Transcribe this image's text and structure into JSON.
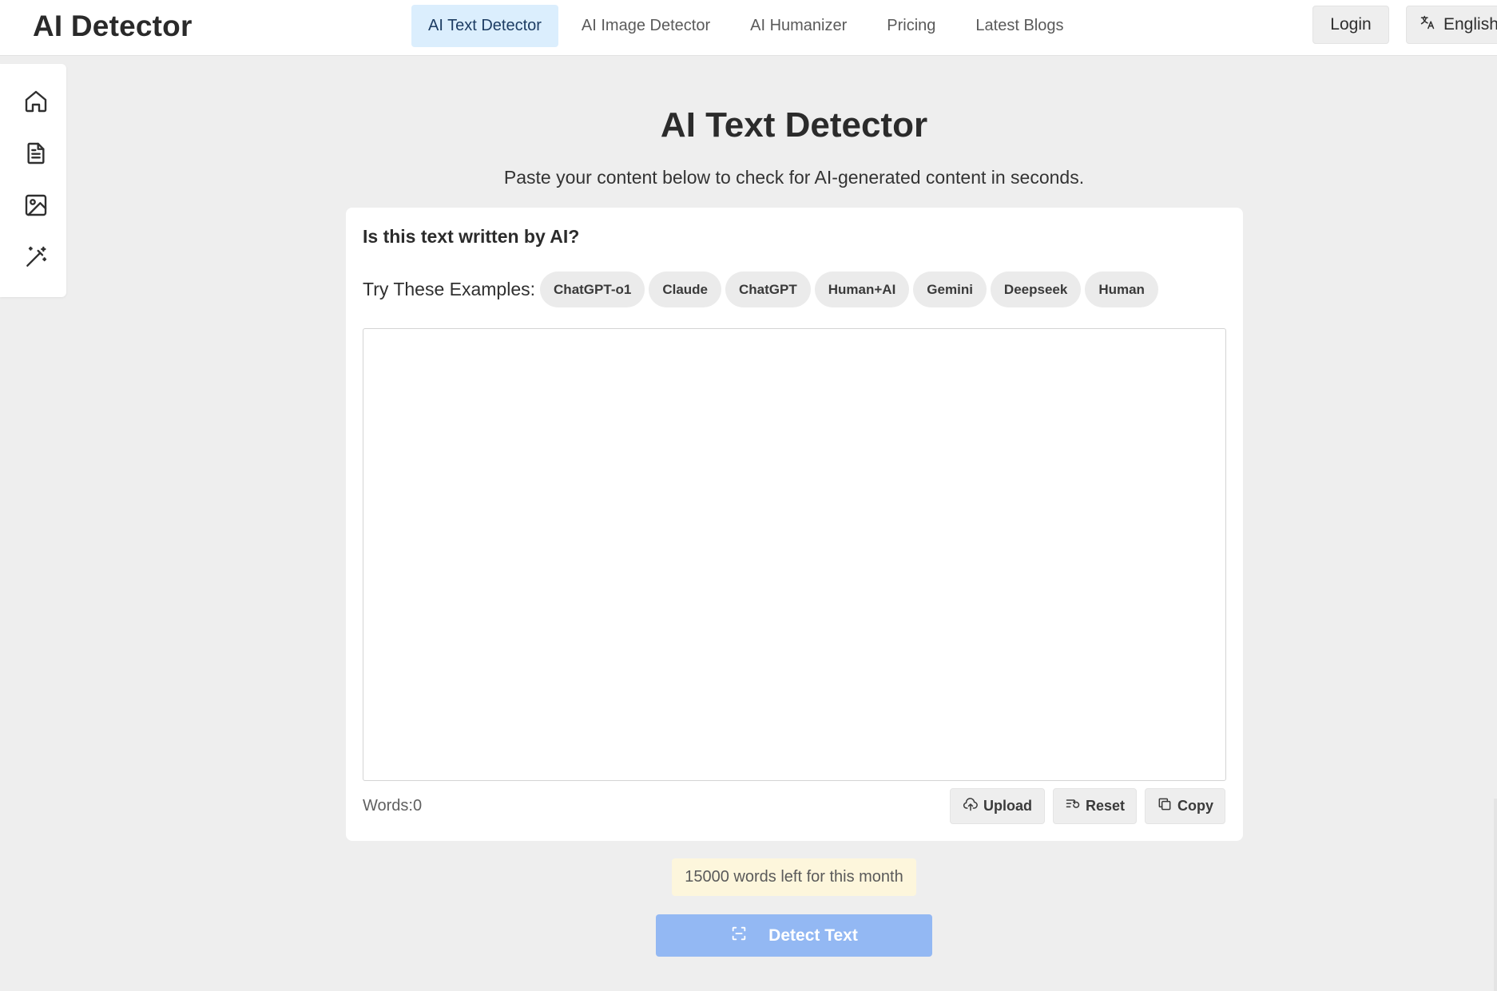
{
  "header": {
    "logo": "AI Detector",
    "nav": [
      {
        "label": "AI Text Detector",
        "active": true
      },
      {
        "label": "AI Image Detector",
        "active": false
      },
      {
        "label": "AI Humanizer",
        "active": false
      },
      {
        "label": "Pricing",
        "active": false
      },
      {
        "label": "Latest Blogs",
        "active": false
      }
    ],
    "login_label": "Login",
    "language_label": "English",
    "language_icon": "translate-icon"
  },
  "sidebar": {
    "icons": [
      "home-icon",
      "document-icon",
      "image-icon",
      "magic-wand-icon"
    ]
  },
  "main": {
    "title": "AI Text Detector",
    "subtitle": "Paste your content below to check for AI-generated content in seconds.",
    "card": {
      "heading": "Is this text written by AI?",
      "examples_label": "Try These Examples:",
      "examples": [
        "ChatGPT-o1",
        "Claude",
        "ChatGPT",
        "Human+AI",
        "Gemini",
        "Deepseek",
        "Human"
      ],
      "textarea_value": "",
      "word_count": "Words:0",
      "actions": {
        "upload": "Upload",
        "reset": "Reset",
        "copy": "Copy"
      }
    },
    "quota_text": "15000 words left for this month",
    "detect_label": "Detect Text"
  },
  "colors": {
    "nav_active_bg": "#dbeefd",
    "detect_button": "#93b8f3",
    "quota_bg": "#fdf6dc"
  }
}
